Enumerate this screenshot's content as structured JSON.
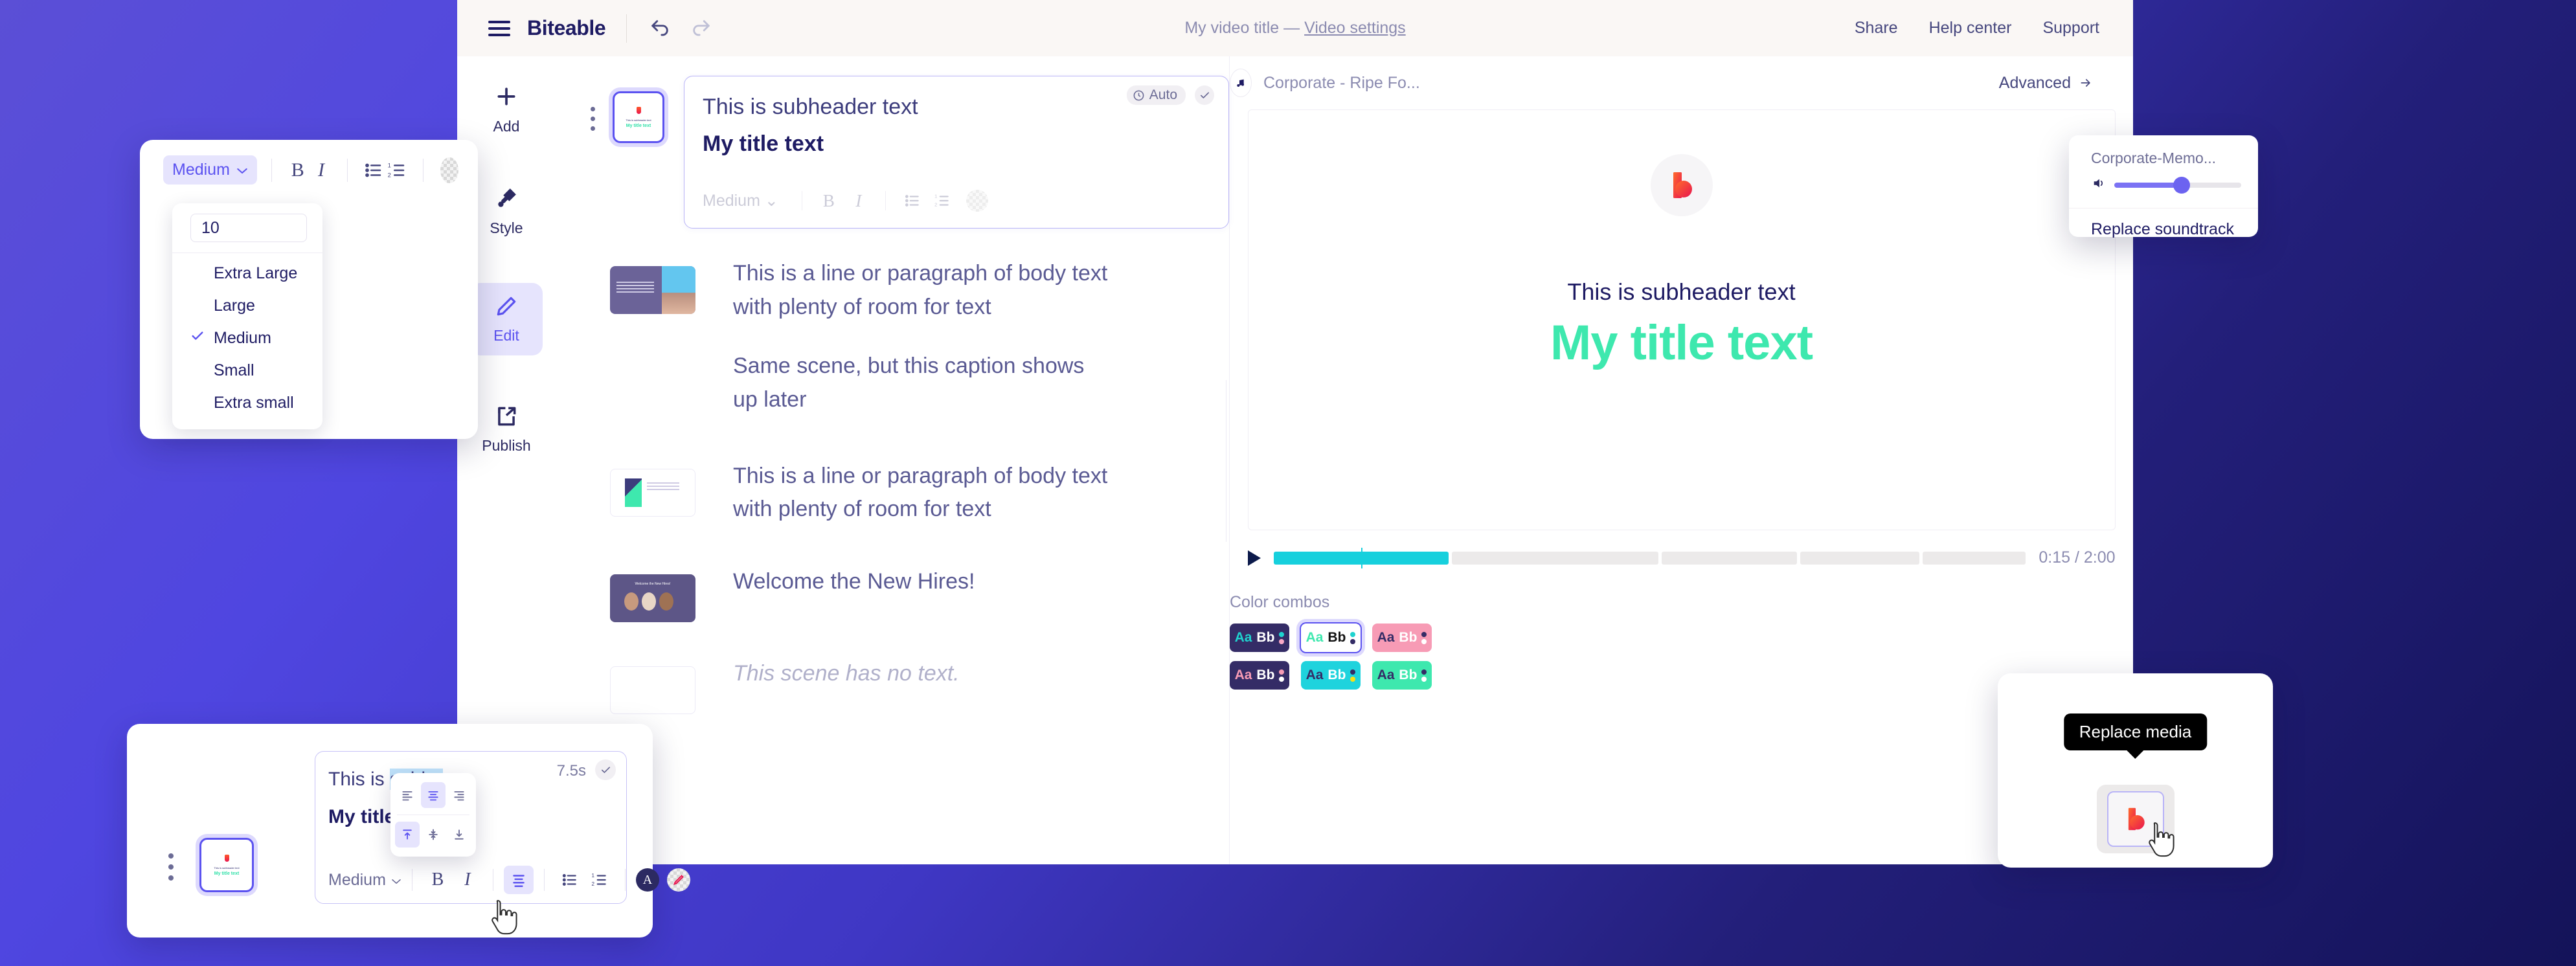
{
  "app": {
    "brand": "Biteable",
    "doc_title_prefix": "My video title — ",
    "doc_settings_link": "Video settings",
    "nav": {
      "share": "Share",
      "help": "Help center",
      "support": "Support"
    }
  },
  "rail": {
    "items": [
      {
        "label": "Add",
        "icon": "plus-icon",
        "active": false
      },
      {
        "label": "Style",
        "icon": "paint-roller-icon",
        "active": false
      },
      {
        "label": "Edit",
        "icon": "pencil-icon",
        "active": true
      },
      {
        "label": "Publish",
        "icon": "share-export-icon",
        "active": false
      }
    ]
  },
  "scenes": [
    {
      "selected": true,
      "subheader": "This is subheader text",
      "title": "My title text",
      "badge": "Auto",
      "thumb_sub": "This is subheader text",
      "thumb_title": "My title text"
    },
    {
      "selected": false,
      "body": "This is a line or paragraph of body text with plenty of room for text"
    },
    {
      "selected": false,
      "body": "Same scene, but this caption shows up later"
    },
    {
      "selected": false,
      "body": "This is a line or paragraph of body text with plenty of room for text"
    },
    {
      "selected": false,
      "body": "Welcome the New Hires!"
    },
    {
      "selected": false,
      "body": "This scene has no text.",
      "muted": true
    }
  ],
  "scene_toolbar": {
    "size_label": "Medium",
    "bold": "B",
    "italic": "I",
    "bullet_list": "bullet-list-icon",
    "numbered_list": "numbered-list-icon",
    "color_swatch": "transparent-swatch-icon"
  },
  "size_panel": {
    "current": "Medium",
    "input_value": "10",
    "options": [
      {
        "label": "Extra Large",
        "checked": false
      },
      {
        "label": "Large",
        "checked": false
      },
      {
        "label": "Medium",
        "checked": true
      },
      {
        "label": "Small",
        "checked": false
      },
      {
        "label": "Extra small",
        "checked": false
      }
    ]
  },
  "preview": {
    "music_name": "Corporate - Ripe Fo...",
    "advanced": "Advanced",
    "stage": {
      "subheader": "This is subheader text",
      "title": "My title text",
      "title_color": "#3ee8ae",
      "subheader_color": "#1e1b63"
    },
    "player": {
      "current_time": "0:15",
      "total_time": "2:00",
      "time_display": "0:15 / 2:00",
      "progress_pct": 12.5
    }
  },
  "color_combos": {
    "title": "Color combos",
    "items": [
      {
        "bg": "#342c66",
        "aa": "#1fd3cf",
        "bb": "#ffffff",
        "dot1": "#1fd3cf",
        "dot2": "#f7a8c6",
        "selected": false
      },
      {
        "bg": "#ffffff",
        "aa": "#3ee8ae",
        "bb": "#111111",
        "dot1": "#1fd3cf",
        "dot2": "#342c66",
        "selected": true
      },
      {
        "bg": "#f79bb5",
        "aa": "#342c66",
        "bb": "#ffffff",
        "dot1": "#342c66",
        "dot2": "#ffffff",
        "selected": false
      },
      {
        "bg": "#342c66",
        "aa": "#f79bb5",
        "bb": "#ffffff",
        "dot1": "#f79bb5",
        "dot2": "#ffffff",
        "selected": false
      },
      {
        "bg": "#1fd3dd",
        "aa": "#342c66",
        "bb": "#ffffff",
        "dot1": "#342c66",
        "dot2": "#f7e017",
        "selected": false
      },
      {
        "bg": "#3ee8ae",
        "aa": "#342c66",
        "bb": "#ffffff",
        "dot1": "#342c66",
        "dot2": "#ffffff",
        "selected": false
      }
    ]
  },
  "edit_panel": {
    "subheader_prefix": "This is ",
    "subheader_selected": "subhe",
    "title": "My title text",
    "duration": "7.5s",
    "size_label": "Medium",
    "bold": "B",
    "italic": "I",
    "thumb_sub": "This is subheader text",
    "thumb_title": "My title text",
    "align_popover": {
      "horizontal": [
        "align-left",
        "align-center",
        "align-right"
      ],
      "horizontal_active": 1,
      "vertical": [
        "align-top",
        "align-middle",
        "align-bottom"
      ],
      "vertical_active": 0
    }
  },
  "soundtrack_panel": {
    "name": "Corporate-Memo...",
    "volume_pct": 53,
    "replace_label": "Replace soundtrack"
  },
  "media_panel": {
    "tooltip": "Replace media"
  },
  "theme": {
    "accent": "#5b52f0",
    "brand_navy": "#1e1b63",
    "mint": "#3ee8ae",
    "bg_gradient_from": "#5b4fd6",
    "bg_gradient_to": "#141359"
  }
}
